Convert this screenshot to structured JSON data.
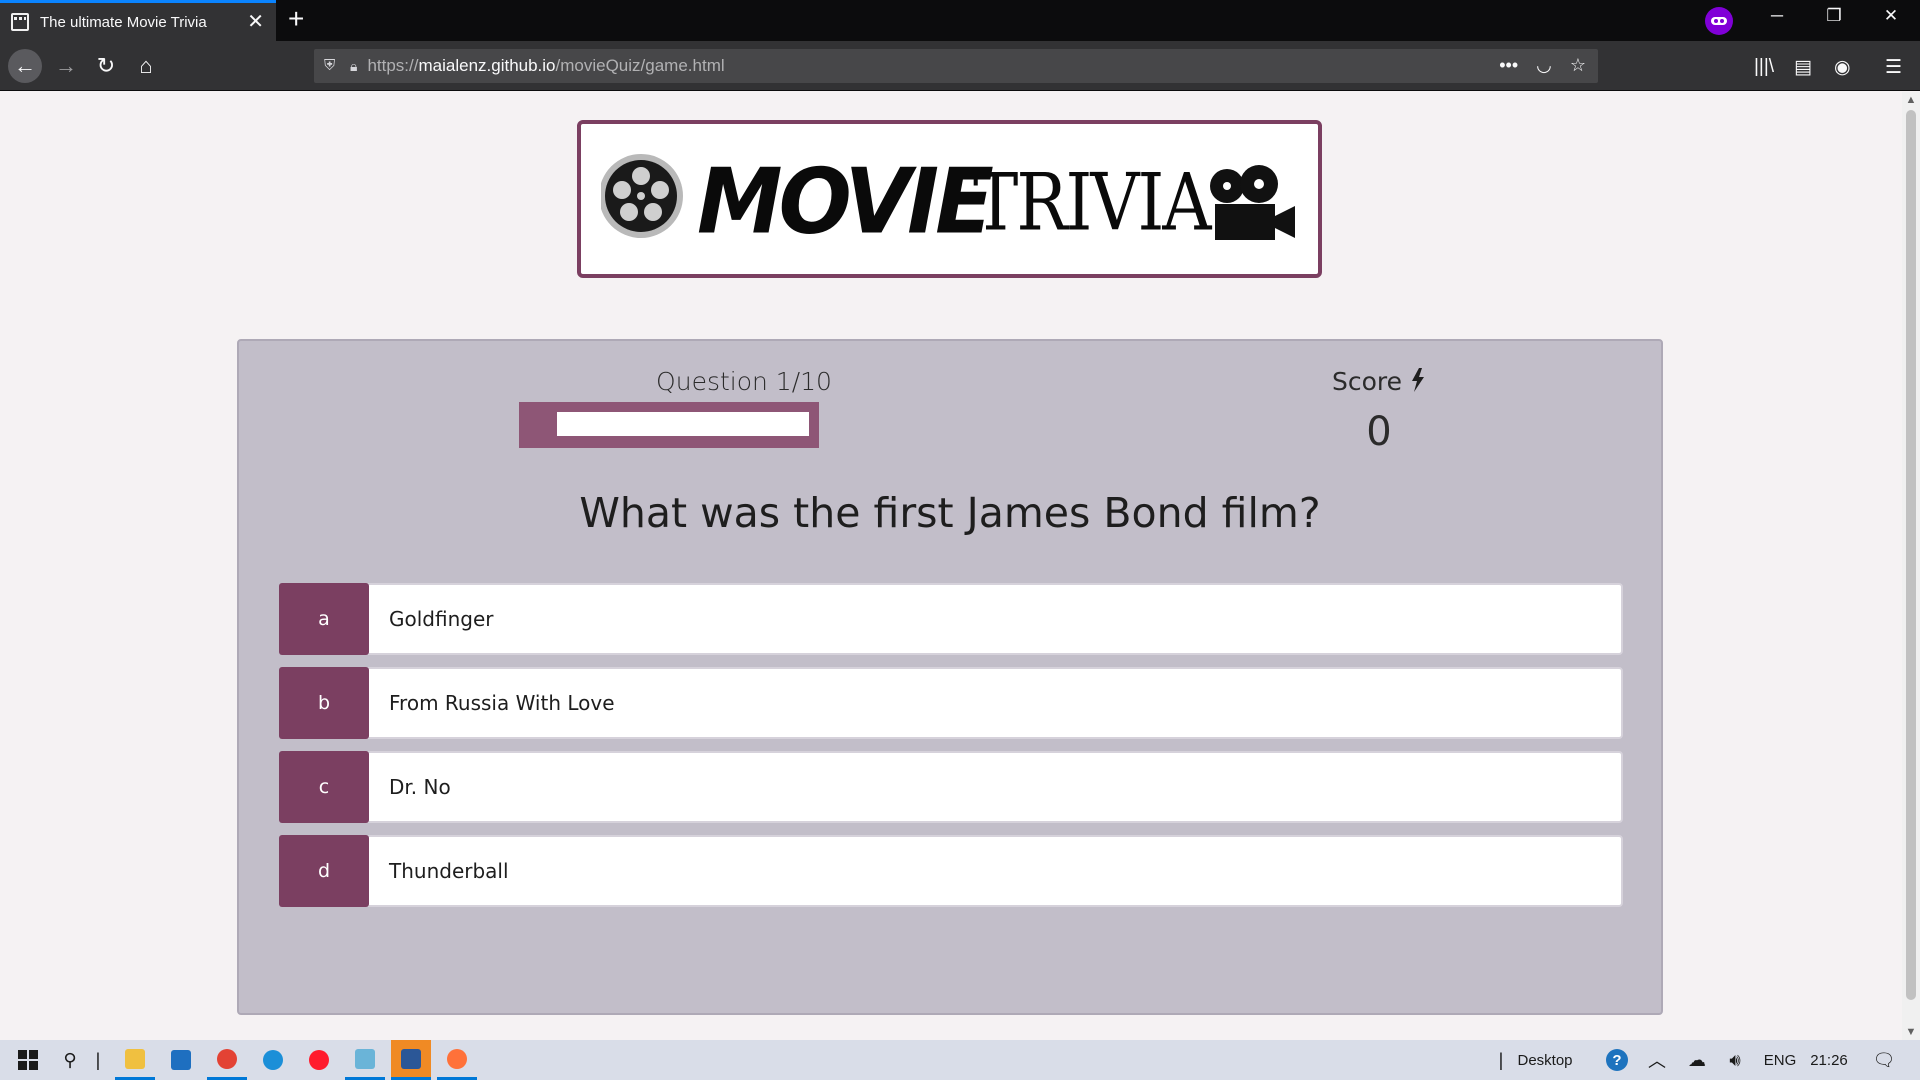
{
  "browser": {
    "tab_title": "The ultimate Movie Trivia",
    "url_prefix": "https://",
    "url_host": "maialenz.github.io",
    "url_path": "/movieQuiz/game.html",
    "accent": "#0a84ff"
  },
  "logo": {
    "bold_word": "MOVIE",
    "thin_word": "TRIVIA"
  },
  "hud": {
    "question_label": "Question 1/10",
    "question_current": 1,
    "question_total": 10,
    "progress_fraction": 0.1,
    "score_label": "Score",
    "score_value": "0"
  },
  "quiz": {
    "question": "What was the first James Bond film?",
    "choices": [
      {
        "prefix": "a",
        "text": "Goldfinger"
      },
      {
        "prefix": "b",
        "text": "From Russia With Love"
      },
      {
        "prefix": "c",
        "text": "Dr. No"
      },
      {
        "prefix": "d",
        "text": "Thunderball"
      }
    ]
  },
  "colors": {
    "brand": "#7b3f61",
    "panel": "#c2bec9",
    "progress_track": "#8e5676"
  },
  "taskbar": {
    "desktop_label": "Desktop",
    "language": "ENG",
    "time": "21:26",
    "apps": [
      "file-explorer-icon",
      "mail-icon",
      "chrome-icon",
      "edge-icon",
      "opera-icon",
      "notepad-icon",
      "word-icon",
      "firefox-icon"
    ]
  }
}
